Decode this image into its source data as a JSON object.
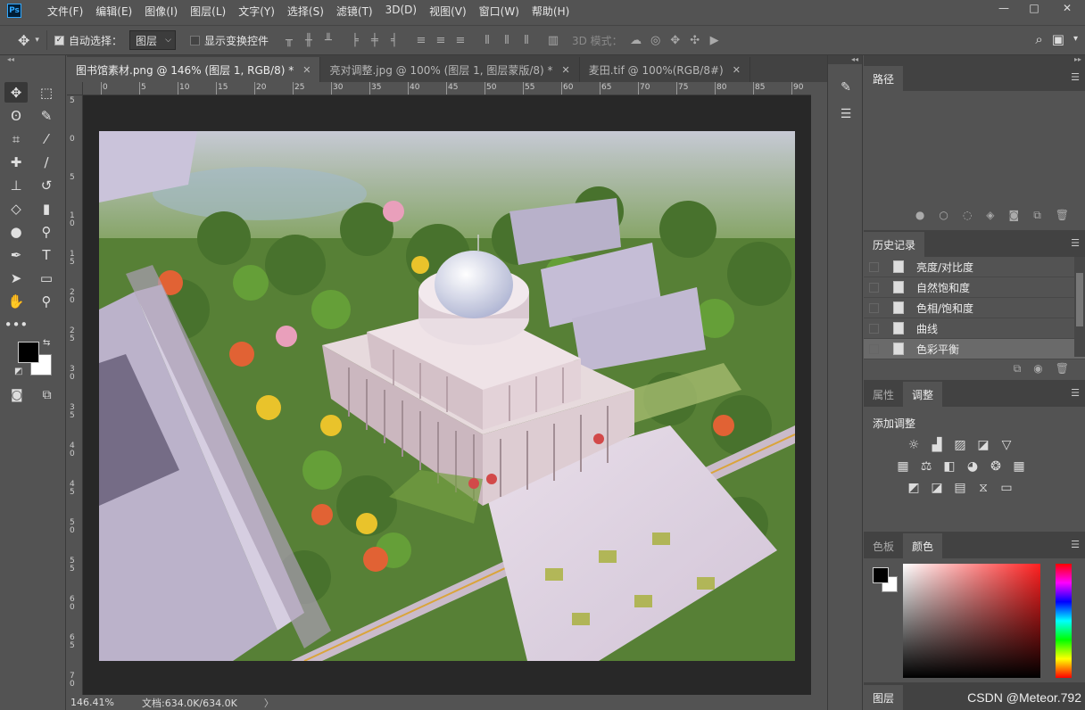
{
  "app": {
    "logo": "Ps"
  },
  "menu": [
    "文件(F)",
    "编辑(E)",
    "图像(I)",
    "图层(L)",
    "文字(Y)",
    "选择(S)",
    "滤镜(T)",
    "3D(D)",
    "视图(V)",
    "窗口(W)",
    "帮助(H)"
  ],
  "window_controls": {
    "minimize": "—",
    "maximize": "□",
    "close": "✕"
  },
  "options": {
    "auto_select_label": "自动选择：",
    "auto_select_checked": true,
    "layer_select_value": "图层",
    "show_transform_label": "显示变换控件",
    "show_transform_checked": false,
    "mode_3d_label": "3D 模式："
  },
  "tabs": [
    {
      "label": "图书馆素材.png @ 146% (图层 1, RGB/8) *",
      "close": "✕"
    },
    {
      "label": "亮对调整.jpg @ 100% (图层 1, 图层蒙版/8) *",
      "close": "✕"
    },
    {
      "label": "麦田.tif @ 100%(RGB/8#)",
      "close": "✕"
    }
  ],
  "ruler_top": [
    "0",
    "5",
    "10",
    "15",
    "20",
    "25",
    "30",
    "35",
    "40",
    "45",
    "50",
    "55",
    "60",
    "65",
    "70",
    "75",
    "80",
    "85",
    "90"
  ],
  "ruler_left": [
    "5",
    "0",
    "5",
    "1 0",
    "1 5",
    "2 0",
    "2 5",
    "3 0",
    "3 5",
    "4 0",
    "4 5",
    "5 0",
    "5 5",
    "6 0",
    "6 5",
    "7 0",
    "7 5"
  ],
  "status": {
    "zoom": "146.41%",
    "doc": "文档:634.0K/634.0K",
    "more": "〉"
  },
  "panels": {
    "paths": {
      "tab": "路径"
    },
    "history": {
      "tab": "历史记录",
      "items": [
        "亮度/对比度",
        "自然饱和度",
        "色相/饱和度",
        "曲线",
        "色彩平衡"
      ],
      "selected_index": 4
    },
    "adjust": {
      "tabs": [
        "属性",
        "调整"
      ],
      "active": 1,
      "title": "添加调整"
    },
    "color": {
      "tabs": [
        "色板",
        "颜色"
      ],
      "active": 1
    },
    "layers": {
      "tab": "图层"
    }
  },
  "watermark": "CSDN @Meteor.792",
  "colors": {
    "ui_bg": "#535353",
    "dark": "#424242",
    "canvas_bg": "#282828",
    "ps_blue": "#31a8ff"
  }
}
